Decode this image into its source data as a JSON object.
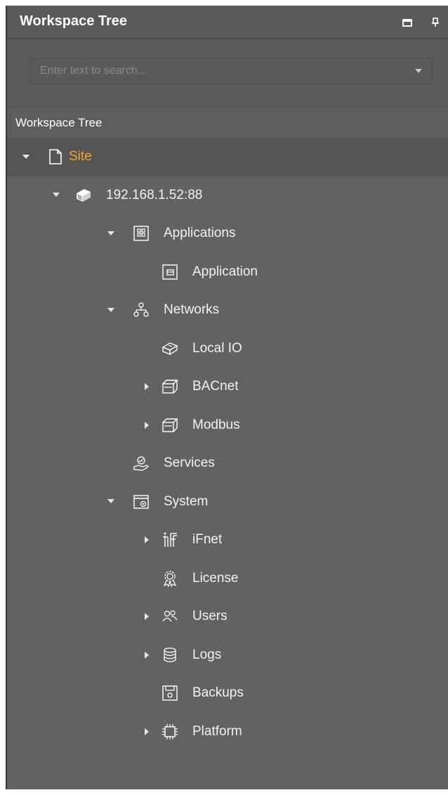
{
  "panel": {
    "title": "Workspace Tree"
  },
  "search": {
    "placeholder": "Enter text to search..."
  },
  "section_header": "Workspace Tree",
  "colors": {
    "panel_bg": "#626262",
    "selected_label": "#f0a328",
    "text": "#f2f2f2"
  },
  "tree": {
    "site": {
      "label": "Site",
      "icon": "page-icon",
      "expanded": true,
      "selected": true
    },
    "host": {
      "label": "192.168.1.52:88",
      "icon": "device-icon",
      "expanded": true
    },
    "applications": {
      "label": "Applications",
      "icon": "applications-icon",
      "expanded": true
    },
    "application": {
      "label": "Application",
      "icon": "application-icon"
    },
    "networks": {
      "label": "Networks",
      "icon": "network-icon",
      "expanded": true
    },
    "local_io": {
      "label": "Local IO",
      "icon": "local-io-icon"
    },
    "bacnet": {
      "label": "BACnet",
      "icon": "protocol-icon",
      "expanded": false
    },
    "modbus": {
      "label": "Modbus",
      "icon": "protocol-icon",
      "expanded": false
    },
    "services": {
      "label": "Services",
      "icon": "services-icon"
    },
    "system": {
      "label": "System",
      "icon": "system-icon",
      "expanded": true
    },
    "ifnet": {
      "label": "iFnet",
      "icon": "ifnet-icon",
      "expanded": false
    },
    "license": {
      "label": "License",
      "icon": "license-icon"
    },
    "users": {
      "label": "Users",
      "icon": "users-icon",
      "expanded": false
    },
    "logs": {
      "label": "Logs",
      "icon": "database-icon",
      "expanded": false
    },
    "backups": {
      "label": "Backups",
      "icon": "floppy-icon"
    },
    "platform": {
      "label": "Platform",
      "icon": "chip-icon",
      "expanded": false
    }
  }
}
